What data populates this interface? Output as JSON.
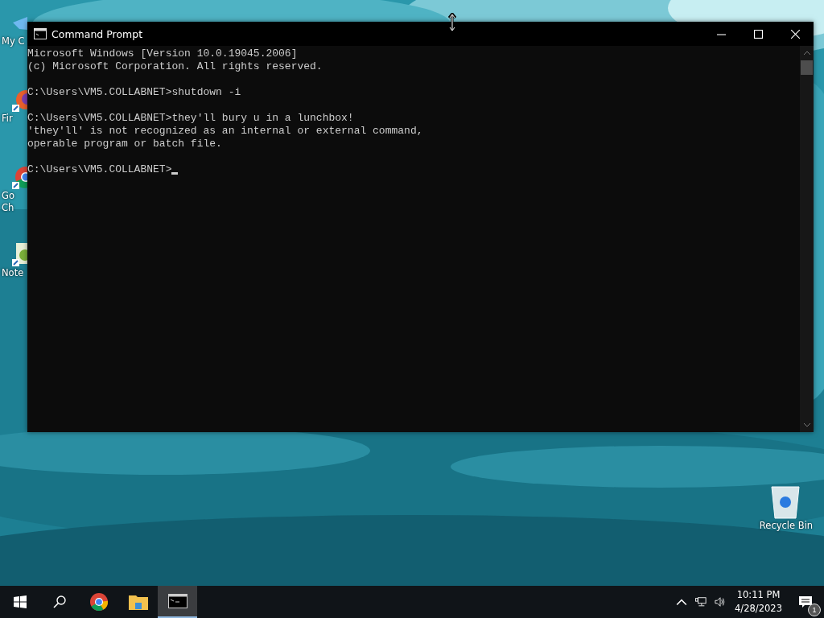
{
  "desktop_icons": [
    {
      "label": "My C",
      "kind": "computer"
    },
    {
      "label": "Fir",
      "kind": "firefox"
    },
    {
      "label": "Go\nCh",
      "kind": "chrome"
    },
    {
      "label": "Note",
      "kind": "notepad"
    },
    {
      "label": "Recycle Bin",
      "kind": "recycle"
    }
  ],
  "window": {
    "title": "Command Prompt",
    "blocks": [
      {
        "kind": "output",
        "lines": [
          "Microsoft Windows [Version 10.0.19045.2006]",
          "(c) Microsoft Corporation. All rights reserved."
        ]
      },
      {
        "kind": "silent_command",
        "lines": [
          "C:\\Users\\VM5.COLLABNET>shutdown -i"
        ]
      },
      {
        "kind": "output",
        "lines": [
          "C:\\Users\\VM5.COLLABNET>they'll bury u in a lunchbox!",
          "'they'll' is not recognized as an internal or external command,",
          "operable program or batch file."
        ]
      },
      {
        "kind": "prompt",
        "lines": [
          "C:\\Users\\VM5.COLLABNET>"
        ]
      }
    ]
  },
  "taskbar": {
    "items": [
      {
        "kind": "start",
        "selected": false
      },
      {
        "kind": "search",
        "selected": false
      },
      {
        "kind": "chrome",
        "selected": false
      },
      {
        "kind": "explorer",
        "selected": false
      },
      {
        "kind": "cmd",
        "selected": true
      }
    ],
    "time": "10:11 PM",
    "date": "4/28/2023",
    "notification_count": "1"
  }
}
